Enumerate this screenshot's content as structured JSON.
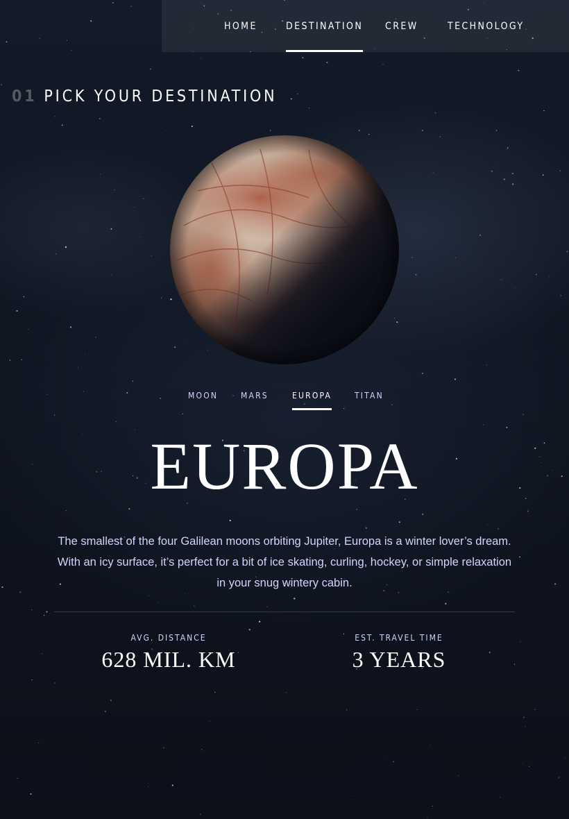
{
  "nav": {
    "items": [
      {
        "label": "HOME"
      },
      {
        "label": "DESTINATION"
      },
      {
        "label": "CREW"
      },
      {
        "label": "TECHNOLOGY"
      }
    ],
    "active": "DESTINATION"
  },
  "heading": {
    "number": "01",
    "title": "PICK YOUR DESTINATION"
  },
  "destination_tabs": {
    "items": [
      {
        "label": "MOON"
      },
      {
        "label": "MARS"
      },
      {
        "label": "EUROPA"
      },
      {
        "label": "TITAN"
      }
    ],
    "active": "EUROPA"
  },
  "destination": {
    "name": "EUROPA",
    "description": "The smallest of the four Galilean moons orbiting Jupiter, Europa is a winter lover’s dream. With an icy surface, it’s perfect for a bit of ice skating, curling, hockey, or simple relaxation in your snug wintery cabin.",
    "distance_label": "AVG. DISTANCE",
    "distance_value": "628 MIL. KM",
    "travel_label": "EST. TRAVEL TIME",
    "travel_value": "3 YEARS"
  },
  "colors": {
    "background": "#0b0d17",
    "accent_text": "#d0d6f9",
    "primary_text": "#ffffff"
  }
}
